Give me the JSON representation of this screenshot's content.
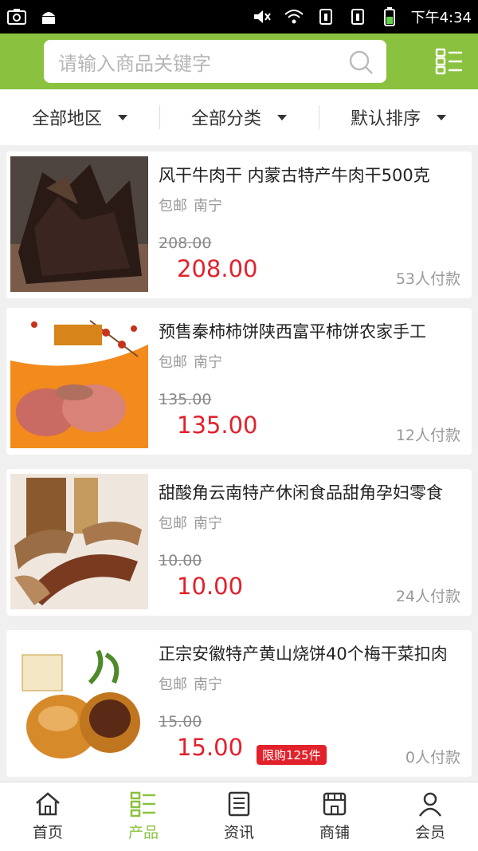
{
  "status_bar": {
    "time": "下午4:34"
  },
  "search": {
    "placeholder": "请输入商品关键字"
  },
  "filters": [
    {
      "label": "全部地区"
    },
    {
      "label": "全部分类"
    },
    {
      "label": "默认排序"
    }
  ],
  "products": [
    {
      "title": "风干牛肉干 内蒙古特产牛肉干500克",
      "shipping": "包邮",
      "location": "南宁",
      "old_price": "208.00",
      "price": "208.00",
      "sold": "53人付款",
      "badge": ""
    },
    {
      "title": "预售秦柿柿饼陕西富平柿饼农家手工",
      "shipping": "包邮",
      "location": "南宁",
      "old_price": "135.00",
      "price": "135.00",
      "sold": "12人付款",
      "badge": ""
    },
    {
      "title": "甜酸角云南特产休闲食品甜角孕妇零食",
      "shipping": "包邮",
      "location": "南宁",
      "old_price": "10.00",
      "price": "10.00",
      "sold": "24人付款",
      "badge": ""
    },
    {
      "title": "正宗安徽特产黄山烧饼40个梅干菜扣肉",
      "shipping": "包邮",
      "location": "南宁",
      "old_price": "15.00",
      "price": "15.00",
      "sold": "0人付款",
      "badge": "限购125件"
    }
  ],
  "bottom_nav": [
    {
      "label": "首页",
      "icon": "home-icon"
    },
    {
      "label": "产品",
      "icon": "grid-list-icon"
    },
    {
      "label": "资讯",
      "icon": "news-icon"
    },
    {
      "label": "商铺",
      "icon": "store-icon"
    },
    {
      "label": "会员",
      "icon": "user-icon"
    }
  ],
  "colors": {
    "accent": "#8ac13f",
    "price": "#e2212b"
  }
}
